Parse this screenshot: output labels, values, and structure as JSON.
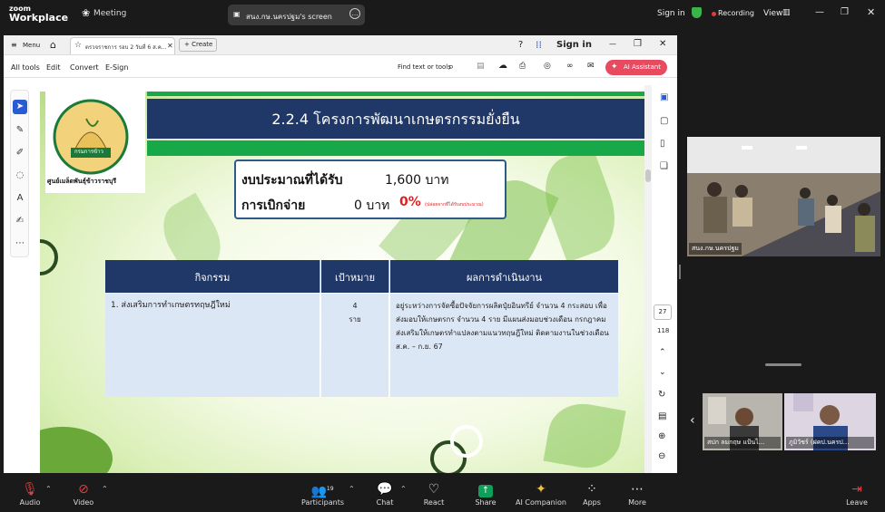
{
  "zoom": {
    "brand_top": "zoom",
    "brand_bottom": "Workplace",
    "meeting_label": "Meeting",
    "screen_title": "สนง.กษ.นครปฐม's screen",
    "sign_in": "Sign in",
    "recording": "Recording",
    "view": "View"
  },
  "pdf": {
    "menu": "Menu",
    "tab_title": "ตรวจราชการ รอบ 2 วันที่ 6 ส.ค...",
    "create": "Create",
    "sign_in": "Sign in",
    "menu_items": [
      "All tools",
      "Edit",
      "Convert",
      "E-Sign"
    ],
    "find_text": "Find text or tools",
    "ai_assistant": "AI Assistant",
    "page_number": "27",
    "page_total": "118"
  },
  "slide": {
    "title": "2.2.4 โครงการพัฒนาเกษตรกรรมยั่งยืน",
    "logo_text": "ศูนย์เมล็ดพันธุ์ข้าวราชบุรี",
    "logo_badge": "กรมการข้าว",
    "budget_label": "งบประมาณที่ได้รับ",
    "budget_value": "1,600 บาท",
    "disburse_label": "การเบิกจ่าย",
    "disburse_value": "0 บาท",
    "disburse_pct": "0%",
    "disburse_note": "(ปล่อยจากที่ได้รับงบประมาณ)",
    "table": {
      "headers": [
        "กิจกรรม",
        "เป้าหมาย",
        "ผลการดำเนินงาน"
      ],
      "row": {
        "activity": "1. ส่งเสริมการทำเกษตรทฤษฎีใหม่",
        "target_num": "4",
        "target_unit": "ราย",
        "result": "อยู่ระหว่างการจัดซื้อปัจจัยการผลิตปุ๋ยอินทรีย์ จำนวน 4 กระสอบ เพื่อส่งมอบให้เกษตรกร จำนวน 4 ราย มีแผนส่งมอบช่วงเดือน กรกฎาคม ส่งเสริมให้เกษตรทำแปลงตามแนวทฤษฎีใหม่ ติดตามงานในช่วงเดือน ส.ค. – ก.ย. 67"
      }
    }
  },
  "participants_panel": {
    "self_name": "สนง.กษ.นครปฐม",
    "thumb1_name": "สปก ลมกฤษ แป้นไ...",
    "thumb2_name": "ภูมิวัชร์ (ฝคป.นครป..."
  },
  "toolbar": {
    "audio": "Audio",
    "video": "Video",
    "participants": "Participants",
    "participants_count": "19",
    "chat": "Chat",
    "react": "React",
    "share": "Share",
    "ai_companion": "AI Companion",
    "apps": "Apps",
    "more": "More",
    "leave": "Leave"
  },
  "colors": {
    "slide_title_bg": "#1f3868",
    "slide_green": "#17a84a",
    "share_green": "#0e9f5a",
    "ai_button": "#e84a5f",
    "recording_dot": "#e03c3c",
    "pct_red": "#e02020"
  }
}
